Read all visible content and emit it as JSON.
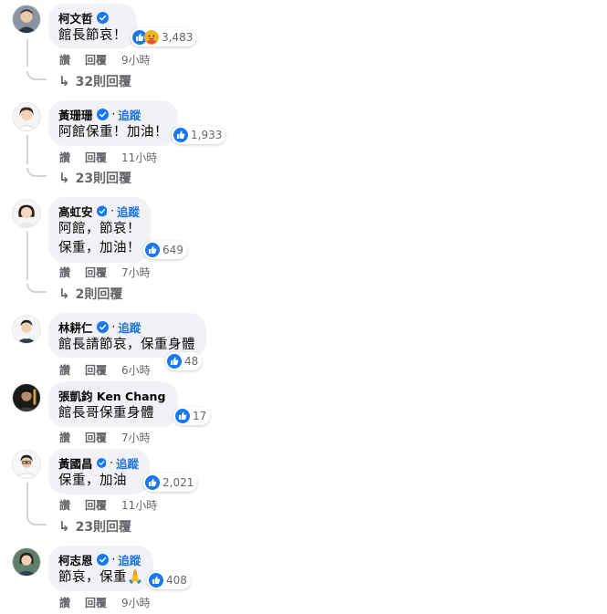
{
  "labels": {
    "like": "讚",
    "reply": "回覆",
    "follow": "追蹤"
  },
  "colors": {
    "accent": "#1b74e4",
    "verified": "#1877f2",
    "bubble": "#f0f2f5",
    "muted": "#65676b"
  },
  "comments": [
    {
      "name": "柯文哲",
      "follow": false,
      "text": [
        "館長節哀！"
      ],
      "reactions": [
        "like-icon",
        "care-icon"
      ],
      "count": "3,483",
      "time": "9小時",
      "replies": "32則回覆"
    },
    {
      "name": "黃珊珊",
      "follow": true,
      "text": [
        "阿館保重！加油！"
      ],
      "reactions": [
        "like-icon"
      ],
      "count": "1,933",
      "time": "11小時",
      "replies": "23則回覆"
    },
    {
      "name": "高虹安",
      "follow": true,
      "text": [
        "阿館，節哀！",
        "保重，加油！"
      ],
      "reactions": [
        "like-icon"
      ],
      "count": "649",
      "time": "7小時",
      "replies": "2則回覆"
    },
    {
      "name": "林耕仁",
      "follow": true,
      "text": [
        "館長請節哀，保重身體"
      ],
      "reactions": [
        "like-icon"
      ],
      "count": "48",
      "time": "6小時",
      "replies": ""
    },
    {
      "name": "張凱鈞 Ken Chang",
      "follow": false,
      "text": [
        "館長哥保重身體"
      ],
      "reactions": [
        "like-icon"
      ],
      "count": "17",
      "time": "7小時",
      "replies": ""
    },
    {
      "name": "黃國昌",
      "follow": true,
      "text": [
        "保重，加油"
      ],
      "reactions": [
        "like-icon"
      ],
      "count": "2,021",
      "time": "11小時",
      "replies": "23則回覆"
    },
    {
      "name": "柯志恩",
      "follow": true,
      "text": [
        "節哀，保重🙏"
      ],
      "reactions": [
        "like-icon"
      ],
      "count": "408",
      "time": "9小時",
      "replies": ""
    }
  ]
}
